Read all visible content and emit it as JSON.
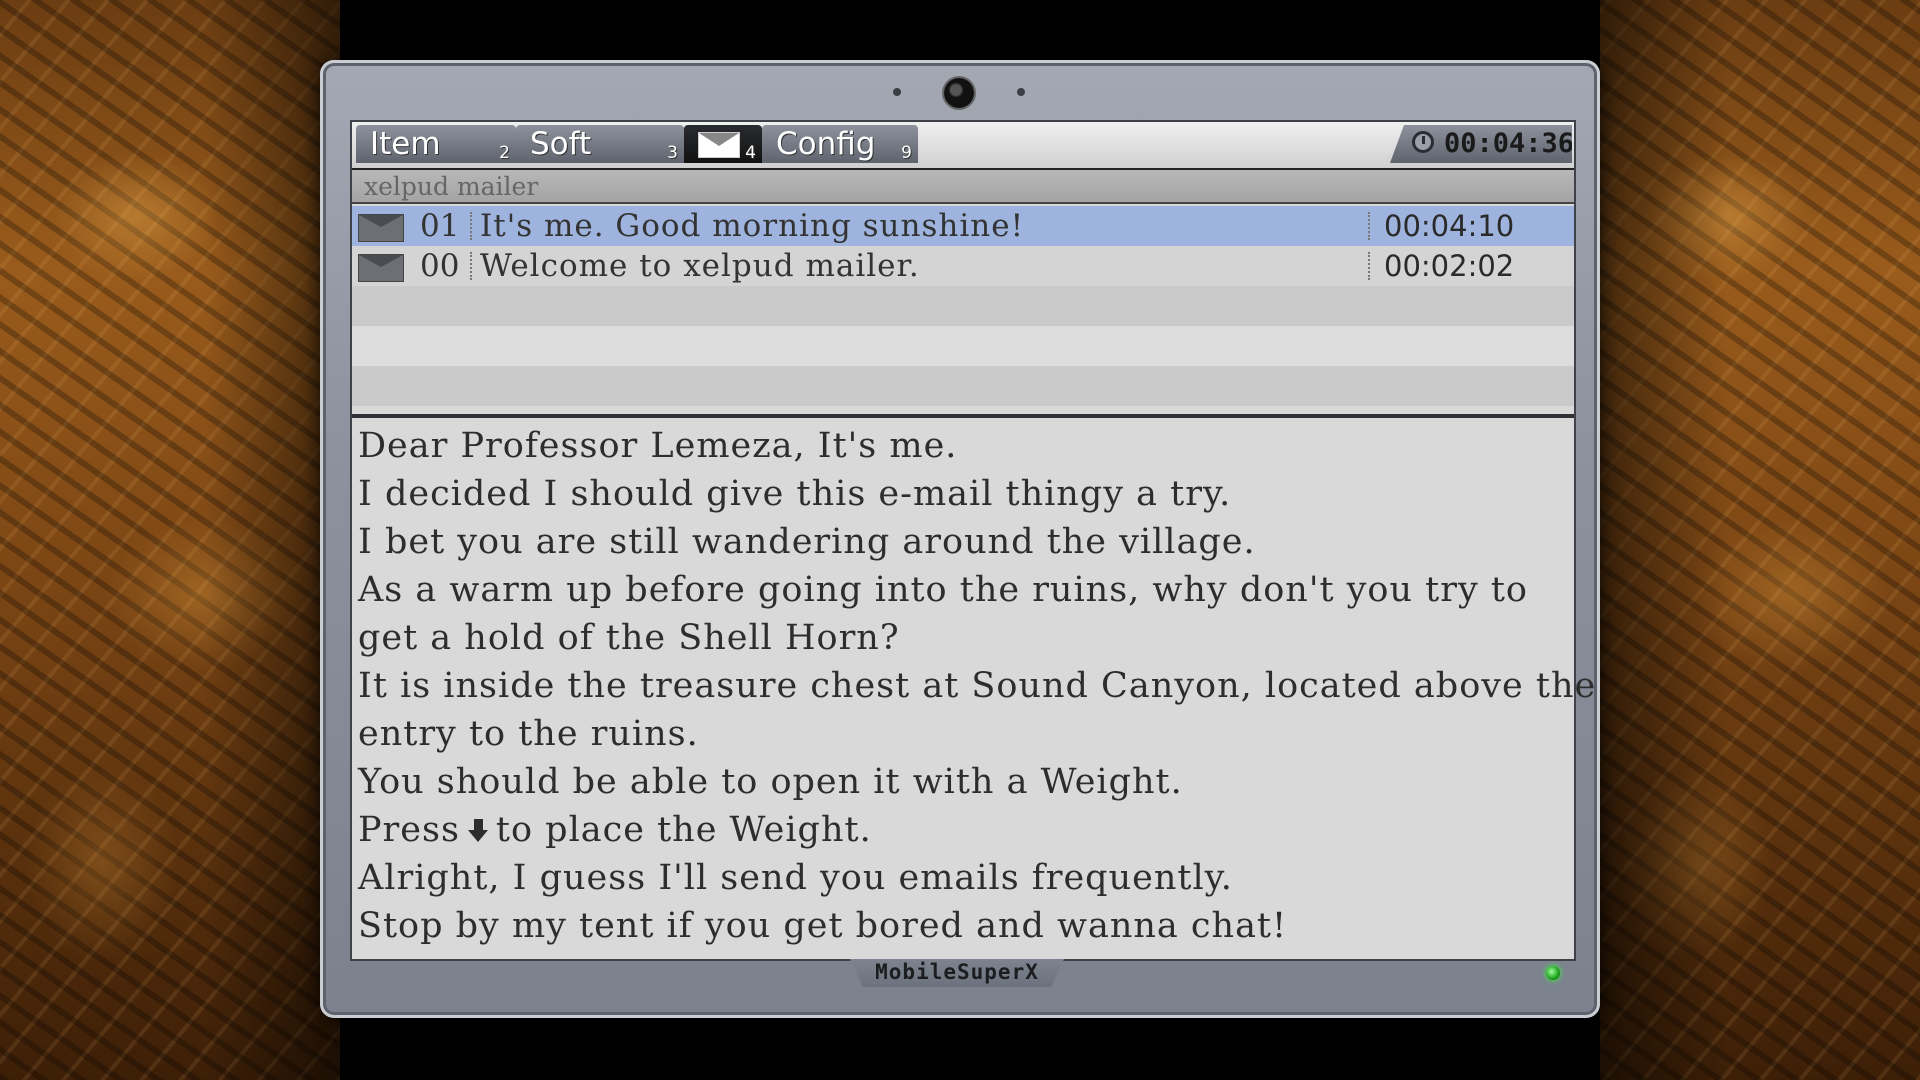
{
  "tabs": [
    {
      "label": "Item",
      "num": "2"
    },
    {
      "label": "Soft",
      "num": "3"
    },
    {
      "label": "",
      "num": "4",
      "icon": "mail-icon"
    },
    {
      "label": "Config",
      "num": "9"
    }
  ],
  "clock": "00:04:36",
  "mailer": {
    "title": "xelpud mailer"
  },
  "mails": [
    {
      "num": "01",
      "subject": "It's me.  Good morning sunshine!",
      "time": "00:04:10",
      "selected": true
    },
    {
      "num": "00",
      "subject": "Welcome to xelpud mailer.",
      "time": "00:02:02",
      "selected": false
    }
  ],
  "body": {
    "lines": [
      "Dear Professor Lemeza, It's me.",
      "I decided I should give this e-mail thingy a try.",
      "I bet you are still wandering around the village.",
      "As a warm up before going into the ruins, why don't you try to",
      "get a hold of the Shell Horn?",
      "It is inside the treasure chest at Sound Canyon, located above the",
      "entry to the ruins.",
      "You should be able to open it with a Weight."
    ],
    "press_prefix": "Press",
    "press_suffix": "to place the Weight.",
    "press_icon": "down-arrow-icon",
    "lines_after": [
      "Alright, I guess I'll send you emails frequently.",
      "Stop by my tent if you get bored and wanna chat!"
    ]
  },
  "brand": "MobileSuperX",
  "colors": {
    "selected_row": "#9eb4de",
    "led": "#1aa01a",
    "backdrop": "#7a4514"
  }
}
